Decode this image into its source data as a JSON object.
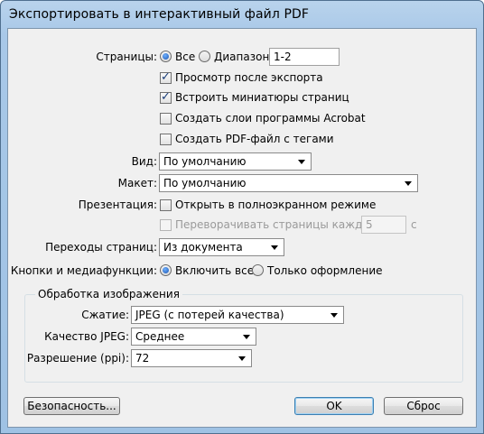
{
  "window": {
    "title": "Экспортировать в интерактивный файл PDF"
  },
  "pages": {
    "label": "Страницы:",
    "all_label": "Все",
    "range_label": "Диапазон:",
    "range_value": "1-2",
    "selected": "all"
  },
  "options": {
    "view_after_export": {
      "label": "Просмотр после экспорта",
      "checked": true
    },
    "embed_thumbnails": {
      "label": "Встроить миниатюры страниц",
      "checked": true
    },
    "create_acrobat_layers": {
      "label": "Создать слои программы Acrobat",
      "checked": false
    },
    "create_tagged_pdf": {
      "label": "Создать PDF-файл с тегами",
      "checked": false
    }
  },
  "view": {
    "label": "Вид:",
    "value": "По умолчанию"
  },
  "layout": {
    "label": "Макет:",
    "value": "По умолчанию"
  },
  "presentation": {
    "label": "Презентация:",
    "fullscreen_label": "Открыть в полноэкранном режиме",
    "flip_label": "Переворачивать страницы каждые:",
    "flip_value": "5",
    "flip_unit": "с"
  },
  "page_transitions": {
    "label": "Переходы страниц:",
    "value": "Из документа"
  },
  "buttons_media": {
    "label": "Кнопки и медиафункции:",
    "include_all_label": "Включить все",
    "appearance_only_label": "Только оформление",
    "selected": "include_all"
  },
  "image_handling": {
    "title": "Обработка изображения",
    "compression": {
      "label": "Сжатие:",
      "value": "JPEG (с потерей качества)"
    },
    "jpeg_quality": {
      "label": "Качество JPEG:",
      "value": "Среднее"
    },
    "resolution": {
      "label": "Разрешение (ppi):",
      "value": "72"
    }
  },
  "footer": {
    "security_label": "Безопасность...",
    "ok_label": "OK",
    "reset_label": "Сброс"
  }
}
